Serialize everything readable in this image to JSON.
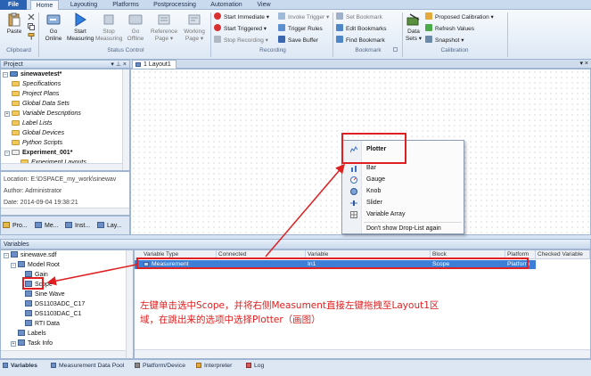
{
  "tabs": [
    "File",
    "Home",
    "Layouting",
    "Platforms",
    "Postprocessing",
    "Automation",
    "View"
  ],
  "ribbon": {
    "clipboard": {
      "paste": "Paste",
      "group": "Clipboard"
    },
    "status_control": {
      "go_online": [
        "Go",
        "Online"
      ],
      "start_measuring": [
        "Start",
        "Measuring"
      ],
      "stop_measuring": [
        "Stop",
        "Measuring"
      ],
      "go_offline": [
        "Go",
        "Offline"
      ],
      "reference_page": [
        "Reference",
        "Page"
      ],
      "working_page": [
        "Working",
        "Page"
      ],
      "group": "Status Control"
    },
    "recording": {
      "start_immediate": "Start Immediate",
      "invoke_trigger": "Invoke Trigger",
      "start_triggered": "Start Triggered",
      "trigger_rules": "Trigger Rules",
      "stop_recording": "Stop Recording",
      "save_buffer": "Save Buffer",
      "group": "Recording"
    },
    "bookmark": {
      "set": "Set Bookmark",
      "edit": "Edit Bookmarks",
      "find": "Find Bookmark",
      "group": "Bookmark"
    },
    "calibration": {
      "data_sets": [
        "Data",
        "Sets"
      ],
      "proposed": "Proposed Calibration",
      "refresh": "Refresh Values",
      "snapshot": "Snapshot",
      "group": "Calibration"
    }
  },
  "project": {
    "title": "Project",
    "items": [
      {
        "label": "sinewavetest*",
        "bold": true
      },
      {
        "label": "Specifications"
      },
      {
        "label": "Project Plans"
      },
      {
        "label": "Global Data Sets"
      },
      {
        "label": "Variable Descriptions"
      },
      {
        "label": "Label Lists"
      },
      {
        "label": "Global Devices"
      },
      {
        "label": "Python Scripts"
      },
      {
        "label": "Experiment_001*",
        "bold": true
      },
      {
        "label": "Experiment Layouts"
      }
    ],
    "location": "Location: E:\\DSPACE_my_work\\sinewav",
    "author": "Author: Administrator",
    "date": "Date: 2014-09-04 19:38:21",
    "bottom_tabs": [
      "Pro...",
      "Me...",
      "Inst...",
      "Lay..."
    ]
  },
  "layout": {
    "tab": "1 Layout1",
    "menu": [
      "Plotter",
      "Bar",
      "Gauge",
      "Knob",
      "Slider",
      "Variable Array",
      "Don't show Drop-List again"
    ]
  },
  "variables": {
    "title": "Variables",
    "tree": [
      "sinewave.sdf",
      "Model Root",
      "Gain",
      "Scope",
      "Sine Wave",
      "DS1103ADC_C17",
      "DS1103DAC_C1",
      "RTI Data",
      "Labels",
      "Task Info"
    ],
    "columns": [
      "Variable Type",
      "Connected",
      "Variable",
      "Block",
      "Platform",
      "Checked Variable"
    ],
    "row": {
      "type": "Measurement",
      "connected": "",
      "variable": "In1",
      "block": "Scope",
      "platform": "Platform"
    }
  },
  "annotation": [
    "左键单击选中Scope，并将右侧Measument直接左键拖拽至Layout1区",
    "域，在跳出来的选项中选择Plotter（画图）"
  ],
  "bottom_tabs": [
    "Variables",
    "Measurement Data Pool",
    "Platform/Device",
    "Interpreter",
    "Log"
  ],
  "colors": {
    "annotation": "#e02020",
    "selection": "#3d7fd6",
    "ribbon_blue": "#2a63b4"
  }
}
